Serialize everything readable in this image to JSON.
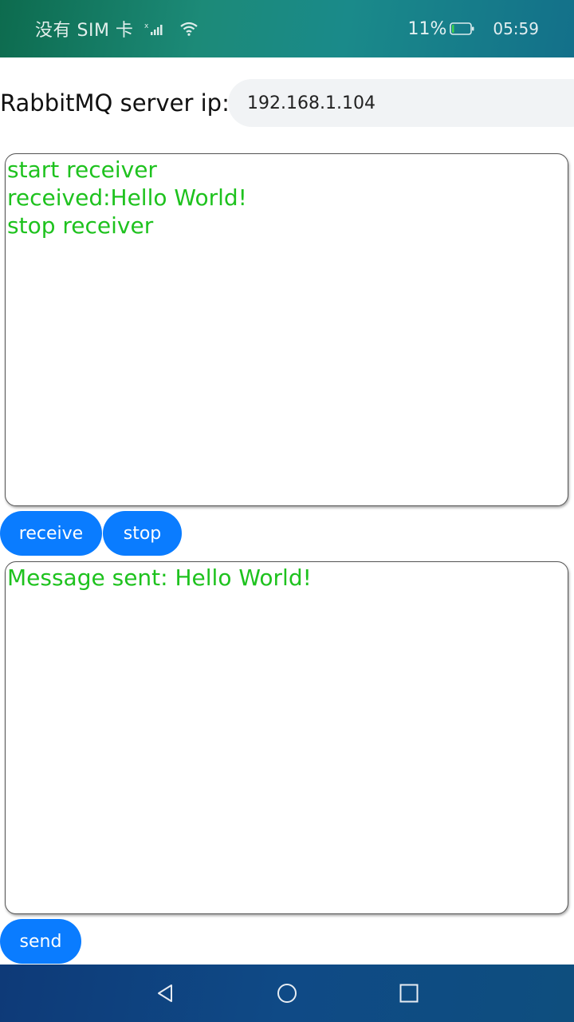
{
  "status_bar": {
    "carrier": "没有 SIM 卡",
    "battery_percent": "11%",
    "battery_level": 0.11,
    "time": "05:59",
    "icons": [
      "signal-icon",
      "wifi-icon",
      "battery-icon"
    ]
  },
  "server": {
    "label": "RabbitMQ server ip:",
    "ip_value": "192.168.1.104"
  },
  "receive_log": {
    "lines": [
      "start receiver",
      "received:Hello World!",
      "stop receiver"
    ]
  },
  "receive_buttons": {
    "receive_label": "receive",
    "stop_label": "stop"
  },
  "send_log": {
    "lines": [
      "Message sent: Hello World!"
    ]
  },
  "send_buttons": {
    "send_label": "send"
  },
  "nav_bar": {
    "icons": [
      "back-icon",
      "home-icon",
      "recent-apps-icon"
    ]
  },
  "colors": {
    "accent": "#0a7cff",
    "log_text": "#1ec21e",
    "input_bg": "#f1f3f5"
  }
}
